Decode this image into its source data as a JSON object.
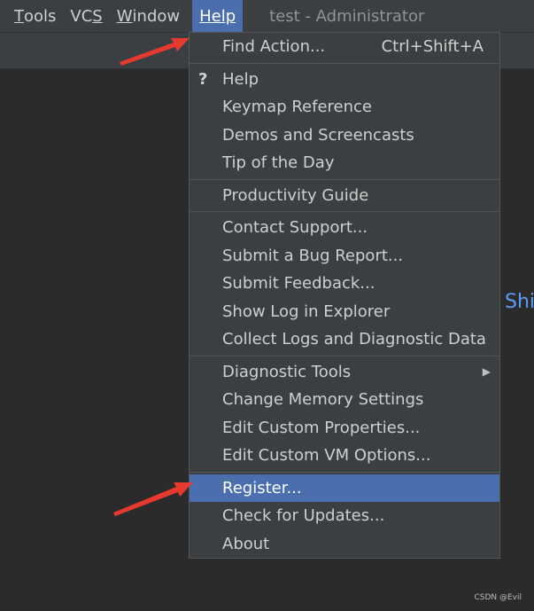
{
  "menubar": {
    "items": [
      {
        "label": "Tools",
        "mnemonic_index": 0
      },
      {
        "label": "VCS",
        "mnemonic_index": 2
      },
      {
        "label": "Window",
        "mnemonic_index": 0
      },
      {
        "label": "Help",
        "mnemonic_index": 0
      }
    ],
    "window_title": "test - Administrator"
  },
  "editor": {
    "partial_text": "Shi"
  },
  "help_menu": {
    "find_action": {
      "label": "Find Action...",
      "shortcut": "Ctrl+Shift+A"
    },
    "group1": [
      {
        "label": "Help"
      },
      {
        "label": "Keymap Reference"
      },
      {
        "label": "Demos and Screencasts"
      },
      {
        "label": "Tip of the Day"
      }
    ],
    "group2": [
      {
        "label": "Productivity Guide"
      }
    ],
    "group3": [
      {
        "label": "Contact Support..."
      },
      {
        "label": "Submit a Bug Report..."
      },
      {
        "label": "Submit Feedback..."
      },
      {
        "label": "Show Log in Explorer"
      },
      {
        "label": "Collect Logs and Diagnostic Data"
      }
    ],
    "group4": [
      {
        "label": "Diagnostic Tools"
      },
      {
        "label": "Change Memory Settings"
      },
      {
        "label": "Edit Custom Properties..."
      },
      {
        "label": "Edit Custom VM Options..."
      }
    ],
    "group5": [
      {
        "label": "Register..."
      },
      {
        "label": "Check for Updates..."
      },
      {
        "label": "About"
      }
    ]
  },
  "watermark": "CSDN @Evil",
  "colors": {
    "background": "#2b2b2b",
    "menubar": "#3c3f41",
    "selection": "#4b6eaf",
    "annotation_arrow": "#e8392f",
    "link_text": "#589df6"
  },
  "icons": {
    "help": "question-mark-icon",
    "submenu": "triangle-right-icon",
    "annotation": "red-arrow-annotation"
  }
}
